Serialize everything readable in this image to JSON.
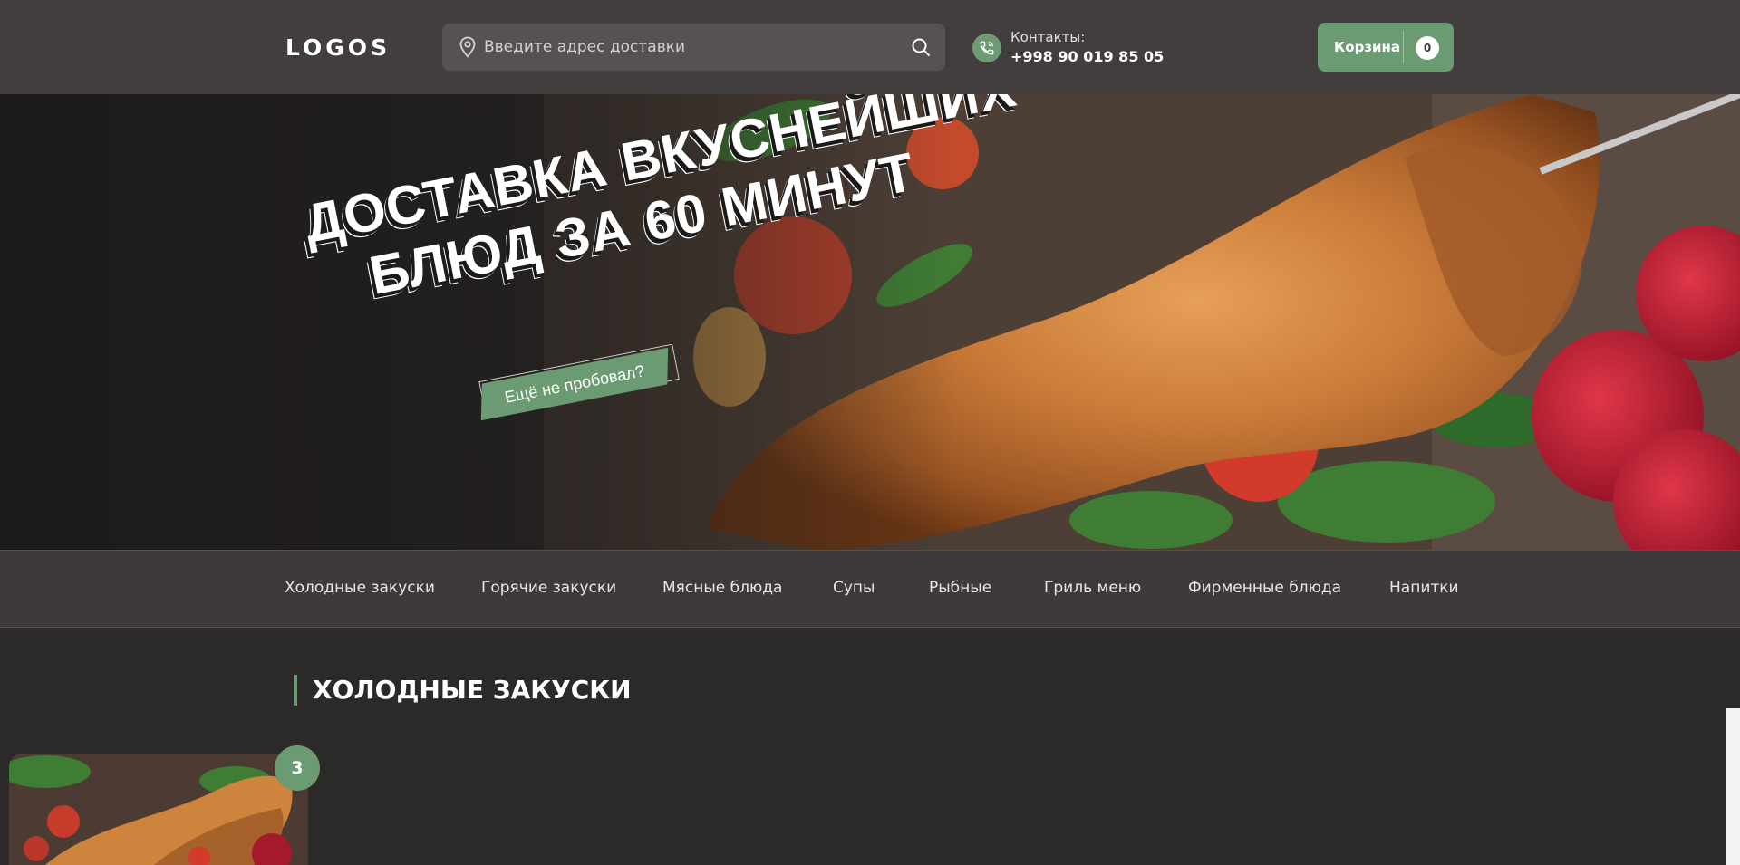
{
  "header": {
    "logo": "LOGOS",
    "search": {
      "placeholder": "Введите адрес доставки"
    },
    "contacts": {
      "label": "Контакты:",
      "phone": "+998 90 019 85 05"
    },
    "cart": {
      "label": "Корзина",
      "count": "0"
    }
  },
  "hero": {
    "title_line1": "Доставка вкуснейших",
    "title_line2": "блюд за 60 минут",
    "tag": "Ещё не пробовал?"
  },
  "menu": {
    "items": [
      {
        "label": "Холодные закуски"
      },
      {
        "label": "Горячие закуски"
      },
      {
        "label": "Мясные блюда"
      },
      {
        "label": "Супы"
      },
      {
        "label": "Рыбные"
      },
      {
        "label": "Гриль меню"
      },
      {
        "label": "Фирменные блюда"
      },
      {
        "label": "Напитки"
      }
    ]
  },
  "section": {
    "title": "Холодные закуски",
    "card_badge": "3"
  },
  "colors": {
    "accent": "#6b9b73",
    "header_bg": "#423e3d",
    "page_bg": "#2c2a29"
  },
  "icons": {
    "search_pin": "location-pin-icon",
    "search": "magnifier-icon",
    "phone": "phone-icon"
  }
}
